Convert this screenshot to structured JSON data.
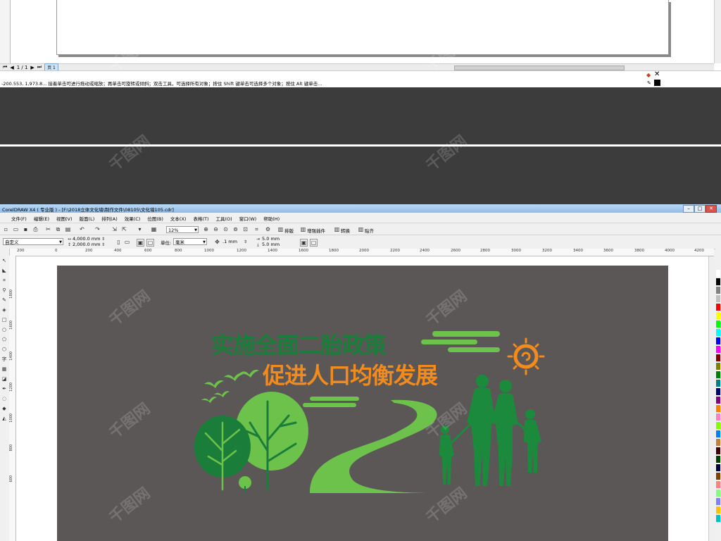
{
  "prev_window": {
    "page_nav": {
      "current": "1 / 1",
      "page_tab": "页 1"
    },
    "status_text": "-200.553, 1,973.8...   接着单击可进行拖动或缩放；再单击可旋转或倾斜；双击工具，可选择所有对象；按住 Shift 键单击可选择多个对象；按住 Alt 键单击..."
  },
  "title_bar": {
    "title": "CorelDRAW X4 ( 专业版 ) - [F:\\2018立体文化墙\\制作文件\\08105\\文化墙105.cdr]"
  },
  "menu": {
    "items": [
      "文件(F)",
      "编辑(E)",
      "视图(V)",
      "版面(L)",
      "排列(A)",
      "效果(C)",
      "位图(B)",
      "文本(X)",
      "表格(T)",
      "工具(O)",
      "窗口(W)",
      "帮助(H)"
    ]
  },
  "toolbar": {
    "zoom": "12%",
    "plugins": [
      "排版",
      "增强插件",
      "转换",
      "贴齐"
    ]
  },
  "property_bar": {
    "page_preset": "自定义",
    "width": "4,000.0 mm",
    "height": "2,000.0 mm",
    "units_label": "单位:",
    "units": "毫米",
    "nudge": ".1 mm",
    "dup_x": "5.0 mm",
    "dup_y": "5.0 mm"
  },
  "ruler_top": [
    "200",
    "0",
    "200",
    "400",
    "600",
    "800",
    "1000",
    "1200",
    "1400",
    "1600",
    "1800",
    "2000",
    "2200",
    "2400",
    "2600",
    "2800",
    "3000",
    "3200",
    "3400",
    "3600",
    "3800",
    "4000",
    "4200"
  ],
  "ruler_left": [
    "1800",
    "1600",
    "1400",
    "1200",
    "1000",
    "800",
    "600"
  ],
  "artwork": {
    "headline_1": "实施全面二胎政策",
    "headline_2": "促进人口均衡发展"
  },
  "colors": {
    "artboard": "#5b5756",
    "dark_green": "#1b7d3a",
    "light_green": "#6cc24a",
    "orange": "#f28b1e"
  },
  "watermark": "千图网"
}
